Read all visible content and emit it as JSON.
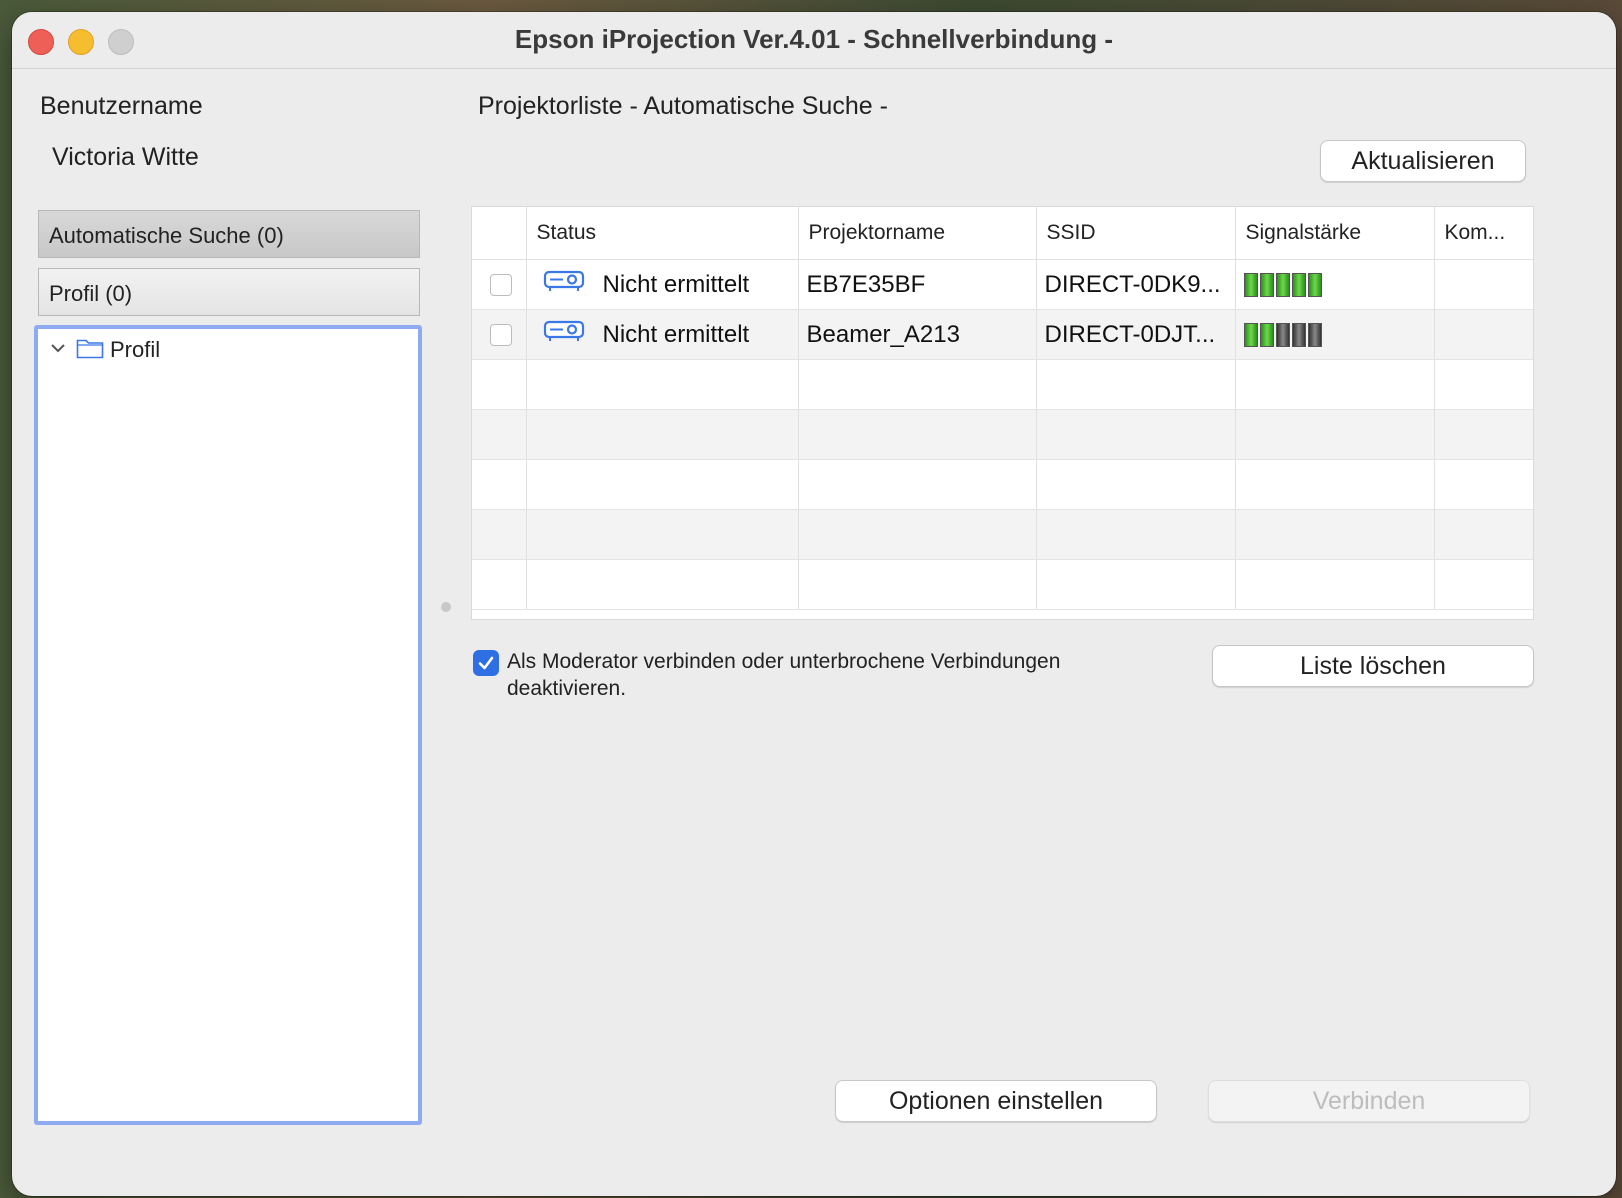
{
  "window": {
    "title": "Epson iProjection Ver.4.01 - Schnellverbindung -"
  },
  "user": {
    "label": "Benutzername",
    "name": "Victoria Witte"
  },
  "sidebar": {
    "auto_search": "Automatische Suche (0)",
    "profile": "Profil (0)",
    "tree": {
      "root_label": "Profil"
    }
  },
  "main": {
    "list_title": "Projektorliste  - Automatische Suche -",
    "refresh_label": "Aktualisieren",
    "columns": [
      "Status",
      "Projektorname",
      "SSID",
      "Signalstärke",
      "Kom..."
    ],
    "rows": [
      {
        "status": "Nicht ermittelt",
        "name": "EB7E35BF",
        "ssid": "DIRECT-0DK9...",
        "signal": 5,
        "signal_max": 5,
        "checked": false
      },
      {
        "status": "Nicht ermittelt",
        "name": "Beamer_A213",
        "ssid": "DIRECT-0DJT...",
        "signal": 2,
        "signal_max": 5,
        "checked": false
      }
    ],
    "moderator_checkbox": {
      "checked": true,
      "label_line1": "Als Moderator verbinden oder unterbrochene Verbindungen",
      "label_line2": "deaktivieren."
    },
    "clear_list_label": "Liste löschen",
    "options_label": "Optionen einstellen",
    "connect_label": "Verbinden"
  },
  "colors": {
    "accent": "#2f6fe4",
    "focus_ring": "#8eaaf0",
    "signal_on": "#4fc52f",
    "signal_off": "#555555"
  }
}
